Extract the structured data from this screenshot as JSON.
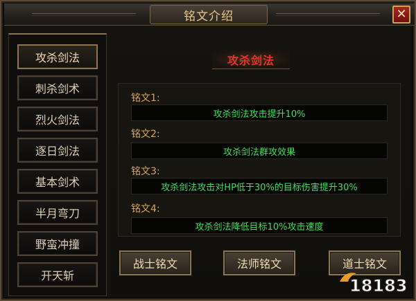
{
  "window": {
    "title": "铭文介绍",
    "close_label": "✕"
  },
  "sidebar": {
    "items": [
      {
        "label": "攻杀剑法",
        "active": true
      },
      {
        "label": "刺杀剑术",
        "active": false
      },
      {
        "label": "烈火剑法",
        "active": false
      },
      {
        "label": "逐日剑法",
        "active": false
      },
      {
        "label": "基本剑术",
        "active": false
      },
      {
        "label": "半月弯刀",
        "active": false
      },
      {
        "label": "野蛮冲撞",
        "active": false
      },
      {
        "label": "开天斩",
        "active": false
      }
    ]
  },
  "main": {
    "skill_title": "攻杀剑法",
    "runes": [
      {
        "label": "铭文1:",
        "effect": "攻杀剑法攻击提升10%"
      },
      {
        "label": "铭文2:",
        "effect": "攻杀剑法群攻效果"
      },
      {
        "label": "铭文3:",
        "effect": "攻杀剑法攻击对HP低于30%的目标伤害提升30%"
      },
      {
        "label": "铭文4:",
        "effect": "攻杀剑法降低目标10%攻击速度"
      }
    ]
  },
  "footer": {
    "warrior_label": "战士铭文",
    "mage_label": "法师铭文",
    "taoist_label": "道士铭文"
  },
  "watermark": {
    "text": "18183"
  },
  "colors": {
    "accent_gold": "#d6a557",
    "skill_title_red": "#e8322a",
    "effect_green": "#3fe05a",
    "close_red": "#a8261c"
  }
}
